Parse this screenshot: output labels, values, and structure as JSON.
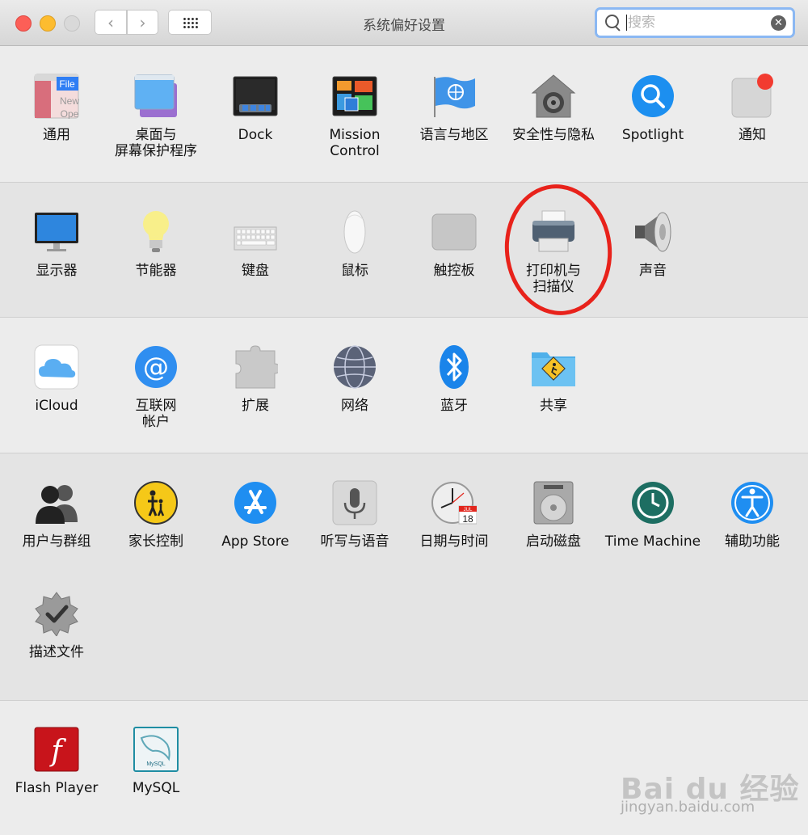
{
  "window": {
    "title": "系统偏好设置",
    "back_glyph": "‹",
    "forward_glyph": "›"
  },
  "search": {
    "placeholder": "搜索",
    "value": ""
  },
  "sections": [
    {
      "items": [
        {
          "label": "通用",
          "icon": "general-icon"
        },
        {
          "label": "桌面与\n屏幕保护程序",
          "icon": "desktop-screensaver-icon"
        },
        {
          "label": "Dock",
          "icon": "dock-icon"
        },
        {
          "label": "Mission\nControl",
          "icon": "mission-control-icon"
        },
        {
          "label": "语言与地区",
          "icon": "language-region-icon"
        },
        {
          "label": "安全性与隐私",
          "icon": "security-privacy-icon"
        },
        {
          "label": "Spotlight",
          "icon": "spotlight-icon"
        },
        {
          "label": "通知",
          "icon": "notifications-icon"
        }
      ]
    },
    {
      "items": [
        {
          "label": "显示器",
          "icon": "displays-icon"
        },
        {
          "label": "节能器",
          "icon": "energy-saver-icon"
        },
        {
          "label": "键盘",
          "icon": "keyboard-icon"
        },
        {
          "label": "鼠标",
          "icon": "mouse-icon"
        },
        {
          "label": "触控板",
          "icon": "trackpad-icon"
        },
        {
          "label": "打印机与\n扫描仪",
          "icon": "printers-scanners-icon"
        },
        {
          "label": "声音",
          "icon": "sound-icon"
        }
      ]
    },
    {
      "items": [
        {
          "label": "iCloud",
          "icon": "icloud-icon"
        },
        {
          "label": "互联网\n帐户",
          "icon": "internet-accounts-icon"
        },
        {
          "label": "扩展",
          "icon": "extensions-icon"
        },
        {
          "label": "网络",
          "icon": "network-icon"
        },
        {
          "label": "蓝牙",
          "icon": "bluetooth-icon"
        },
        {
          "label": "共享",
          "icon": "sharing-icon"
        }
      ]
    },
    {
      "items": [
        {
          "label": "用户与群组",
          "icon": "users-groups-icon"
        },
        {
          "label": "家长控制",
          "icon": "parental-controls-icon"
        },
        {
          "label": "App Store",
          "icon": "app-store-icon"
        },
        {
          "label": "听写与语音",
          "icon": "dictation-speech-icon"
        },
        {
          "label": "日期与时间",
          "icon": "date-time-icon"
        },
        {
          "label": "启动磁盘",
          "icon": "startup-disk-icon"
        },
        {
          "label": "Time Machine",
          "icon": "time-machine-icon"
        },
        {
          "label": "辅助功能",
          "icon": "accessibility-icon"
        },
        {
          "label": "描述文件",
          "icon": "profiles-icon"
        }
      ]
    },
    {
      "items": [
        {
          "label": "Flash Player",
          "icon": "flash-player-icon"
        },
        {
          "label": "MySQL",
          "icon": "mysql-icon"
        }
      ]
    }
  ],
  "icon_text": {
    "general_file": "File",
    "general_new": "New",
    "general_open": "Ope",
    "calendar_month": "JUL",
    "calendar_day": "18",
    "flash_glyph": "f",
    "mysql_small": "MySQL"
  },
  "annotation": {
    "highlight_color": "#e8221b",
    "highlighted_item": "打印机与\n扫描仪"
  },
  "watermark": {
    "logo": "Bai du 经验",
    "url": "jingyan.baidu.com"
  },
  "colors": {
    "close": "#fc5f57",
    "minimize": "#fdbc2f",
    "zoom": "#d9d9d9",
    "search_focus": "#8bb8f3"
  }
}
